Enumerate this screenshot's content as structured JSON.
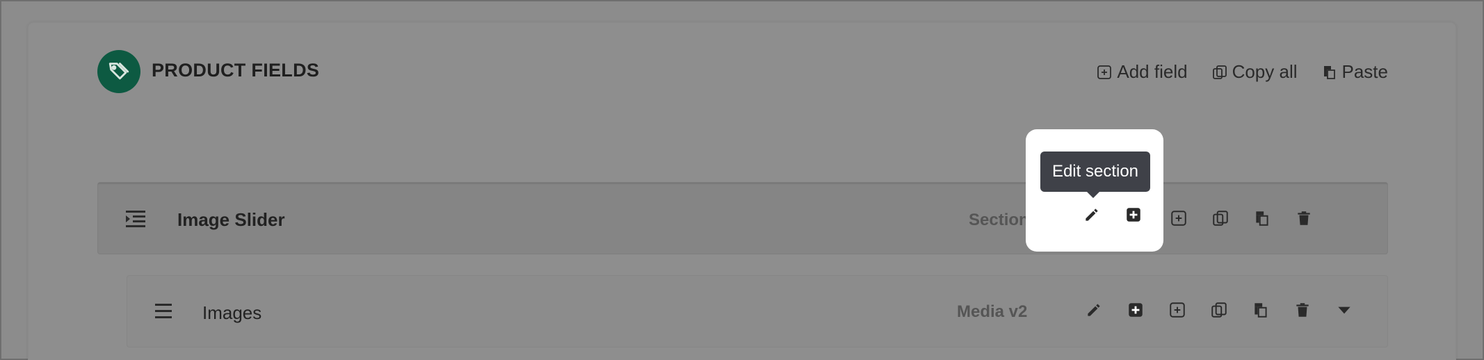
{
  "header": {
    "title": "PRODUCT FIELDS",
    "icon": "tags-icon",
    "accent_color": "#0d5a42"
  },
  "toolbar": {
    "add_field": "Add field",
    "copy_all": "Copy all",
    "paste": "Paste"
  },
  "section": {
    "label": "Image Slider",
    "type": "Section"
  },
  "field": {
    "label": "Images",
    "type": "Media v2"
  },
  "tooltip": {
    "text": "Edit section"
  }
}
